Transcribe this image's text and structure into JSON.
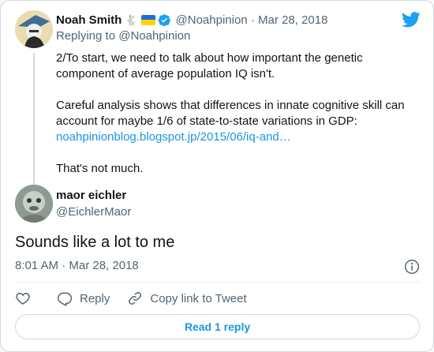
{
  "parent": {
    "name": "Noah Smith",
    "name_emoji": "🐇",
    "handle": "@Noahpinion",
    "date": "· Mar 28, 2018",
    "replying_prefix": "Replying to ",
    "replying_to": "@Noahpinion",
    "text_lines": [
      "2/To start, we need to talk about how important the genetic",
      "component of average population IQ isn't.",
      "Careful analysis shows that differences in innate cognitive skill can",
      "account for maybe 1/6 of state-to-state variations in GDP:",
      "That's not much."
    ],
    "link": "noahpinionblog.blogspot.jp/2015/06/iq-and…"
  },
  "reply": {
    "name": "maor eichler",
    "handle": "@EichlerMaor",
    "text": "Sounds like a lot to me",
    "meta": "8:01 AM · Mar 28, 2018"
  },
  "actions": {
    "reply_label": "Reply",
    "copy_label": "Copy link to Tweet",
    "read_replies": "Read 1 reply"
  },
  "colors": {
    "link": "#1b95e0",
    "muted": "#536471",
    "brand": "#1da1f2"
  }
}
